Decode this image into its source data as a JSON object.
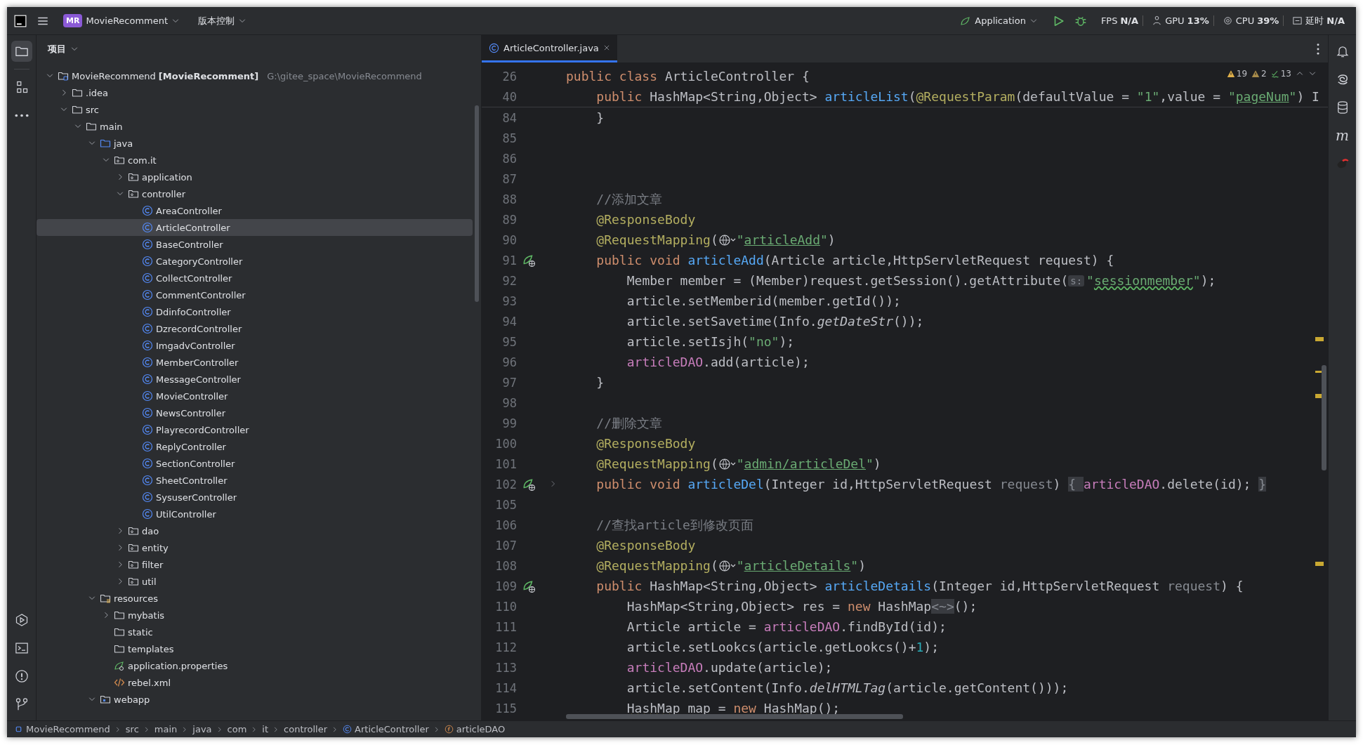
{
  "titlebar": {
    "project_badge": "MR",
    "project": "MovieRecomment",
    "vcs": "版本控制",
    "run_config": "Application",
    "monitors": [
      {
        "kind": "fps",
        "label": "FPS",
        "value": "N/A"
      },
      {
        "kind": "gpu",
        "label": "GPU",
        "value": "13%"
      },
      {
        "kind": "cpu",
        "label": "CPU",
        "value": "39%"
      },
      {
        "kind": "latency",
        "label": "延时",
        "value": "N/A"
      }
    ]
  },
  "left_toolbar": {
    "top": [
      {
        "kind": "project",
        "selected": true
      },
      {
        "kind": "structure",
        "selected": false
      },
      {
        "kind": "more",
        "selected": false
      }
    ],
    "bottom": [
      {
        "kind": "run",
        "selected": false
      },
      {
        "kind": "terminal",
        "selected": false
      },
      {
        "kind": "problems",
        "selected": false
      },
      {
        "kind": "git",
        "selected": false
      }
    ]
  },
  "right_toolbar": [
    {
      "kind": "notifications"
    },
    {
      "kind": "ai"
    },
    {
      "kind": "database"
    },
    {
      "kind": "letter",
      "label": "m"
    },
    {
      "kind": "plugin"
    }
  ],
  "project_panel": {
    "title": "项目",
    "tree": [
      {
        "label": "MovieRecommend",
        "module": "[MovieRecomment]",
        "path": "G:\\gitee_space\\MovieRecommend",
        "kind": "project",
        "expanded": true,
        "selected": false,
        "children": [
          {
            "label": ".idea",
            "kind": "folder",
            "expanded": false,
            "selected": false
          },
          {
            "label": "src",
            "kind": "folder",
            "expanded": true,
            "selected": false,
            "children": [
              {
                "label": "main",
                "kind": "folder",
                "expanded": true,
                "selected": false,
                "children": [
                  {
                    "label": "java",
                    "kind": "source",
                    "expanded": true,
                    "selected": false,
                    "children": [
                      {
                        "label": "com.it",
                        "kind": "package",
                        "expanded": true,
                        "selected": false,
                        "children": [
                          {
                            "label": "application",
                            "kind": "package",
                            "expanded": false,
                            "selected": false
                          },
                          {
                            "label": "controller",
                            "kind": "package",
                            "expanded": true,
                            "selected": false,
                            "children": [
                              {
                                "label": "AreaController",
                                "kind": "class",
                                "selected": false
                              },
                              {
                                "label": "ArticleController",
                                "kind": "class",
                                "selected": true
                              },
                              {
                                "label": "BaseController",
                                "kind": "class",
                                "selected": false
                              },
                              {
                                "label": "CategoryController",
                                "kind": "class",
                                "selected": false
                              },
                              {
                                "label": "CollectController",
                                "kind": "class",
                                "selected": false
                              },
                              {
                                "label": "CommentController",
                                "kind": "class",
                                "selected": false
                              },
                              {
                                "label": "DdinfoController",
                                "kind": "class",
                                "selected": false
                              },
                              {
                                "label": "DzrecordController",
                                "kind": "class",
                                "selected": false
                              },
                              {
                                "label": "ImgadvController",
                                "kind": "class",
                                "selected": false
                              },
                              {
                                "label": "MemberController",
                                "kind": "class",
                                "selected": false
                              },
                              {
                                "label": "MessageController",
                                "kind": "class",
                                "selected": false
                              },
                              {
                                "label": "MovieController",
                                "kind": "class",
                                "selected": false
                              },
                              {
                                "label": "NewsController",
                                "kind": "class",
                                "selected": false
                              },
                              {
                                "label": "PlayrecordController",
                                "kind": "class",
                                "selected": false
                              },
                              {
                                "label": "ReplyController",
                                "kind": "class",
                                "selected": false
                              },
                              {
                                "label": "SectionController",
                                "kind": "class",
                                "selected": false
                              },
                              {
                                "label": "SheetController",
                                "kind": "class",
                                "selected": false
                              },
                              {
                                "label": "SysuserController",
                                "kind": "class",
                                "selected": false
                              },
                              {
                                "label": "UtilController",
                                "kind": "class",
                                "selected": false
                              }
                            ]
                          },
                          {
                            "label": "dao",
                            "kind": "package",
                            "expanded": false,
                            "selected": false
                          },
                          {
                            "label": "entity",
                            "kind": "package",
                            "expanded": false,
                            "selected": false
                          },
                          {
                            "label": "filter",
                            "kind": "package",
                            "expanded": false,
                            "selected": false
                          },
                          {
                            "label": "util",
                            "kind": "package",
                            "expanded": false,
                            "selected": false
                          }
                        ]
                      }
                    ]
                  },
                  {
                    "label": "resources",
                    "kind": "resources",
                    "expanded": true,
                    "selected": false,
                    "children": [
                      {
                        "label": "mybatis",
                        "kind": "folder",
                        "expanded": false,
                        "selected": false
                      },
                      {
                        "label": "static",
                        "kind": "folder",
                        "selected": false
                      },
                      {
                        "label": "templates",
                        "kind": "folder",
                        "selected": false
                      },
                      {
                        "label": "application.properties",
                        "kind": "properties",
                        "selected": false
                      },
                      {
                        "label": "rebel.xml",
                        "kind": "xml",
                        "selected": false
                      }
                    ]
                  },
                  {
                    "label": "webapp",
                    "kind": "web",
                    "expanded": true,
                    "selected": false
                  }
                ]
              }
            ]
          }
        ]
      }
    ]
  },
  "editor": {
    "tabs": [
      {
        "label": "ArticleController.java",
        "selected": true
      }
    ],
    "inspections": {
      "warnings": "19",
      "weak_warnings": "2",
      "typos": "13"
    },
    "sticky_lines": [
      {
        "number": "26",
        "endpoint": false,
        "folded": false,
        "tokens": [
          {
            "kind": "kw",
            "text": "public class "
          },
          {
            "kind": "plain",
            "text": "ArticleController {"
          }
        ]
      },
      {
        "number": "40",
        "endpoint": false,
        "folded": false,
        "tokens": [
          {
            "kind": "kw",
            "text": "    public "
          },
          {
            "kind": "plain",
            "text": "HashMap<String,Object> "
          },
          {
            "kind": "fn",
            "text": "articleList"
          },
          {
            "kind": "plain",
            "text": "("
          },
          {
            "kind": "ann",
            "text": "@RequestParam"
          },
          {
            "kind": "plain",
            "text": "(defaultValue = "
          },
          {
            "kind": "str",
            "text": "\"1\""
          },
          {
            "kind": "plain",
            "text": ",value = "
          },
          {
            "kind": "str",
            "text": "\""
          },
          {
            "kind": "link",
            "text": "pageNum"
          },
          {
            "kind": "str",
            "text": "\""
          },
          {
            "kind": "plain",
            "text": ") I"
          }
        ]
      }
    ],
    "lines": [
      {
        "number": "84",
        "endpoint": false,
        "folded": false,
        "tokens": [
          {
            "kind": "plain",
            "text": "    }"
          }
        ]
      },
      {
        "number": "85",
        "endpoint": false,
        "folded": false
      },
      {
        "number": "86",
        "endpoint": false,
        "folded": false
      },
      {
        "number": "87",
        "endpoint": false,
        "folded": false
      },
      {
        "number": "88",
        "endpoint": false,
        "folded": false,
        "tokens": [
          {
            "kind": "comment",
            "text": "    //添加文章"
          }
        ]
      },
      {
        "number": "89",
        "endpoint": false,
        "folded": false,
        "tokens": [
          {
            "kind": "ann",
            "text": "    @ResponseBody"
          }
        ]
      },
      {
        "number": "90",
        "endpoint": false,
        "folded": false,
        "tokens": [
          {
            "kind": "ann",
            "text": "    @RequestMapping"
          },
          {
            "kind": "plain",
            "text": "("
          },
          {
            "kind": "globe"
          },
          {
            "kind": "str",
            "text": "\""
          },
          {
            "kind": "link",
            "text": "articleAdd"
          },
          {
            "kind": "str",
            "text": "\""
          },
          {
            "kind": "plain",
            "text": ")"
          }
        ]
      },
      {
        "number": "91",
        "endpoint": true,
        "folded": false,
        "tokens": [
          {
            "kind": "kw",
            "text": "    public void "
          },
          {
            "kind": "fn",
            "text": "articleAdd"
          },
          {
            "kind": "plain",
            "text": "(Article article,HttpServletRequest request) {"
          }
        ]
      },
      {
        "number": "92",
        "endpoint": false,
        "folded": false,
        "tokens": [
          {
            "kind": "plain",
            "text": "        Member member = (Member)request.getSession().getAttribute("
          },
          {
            "kind": "hint",
            "text": "s:"
          },
          {
            "kind": "str",
            "text": "\""
          },
          {
            "kind": "typo",
            "text": "sessionmember"
          },
          {
            "kind": "str",
            "text": "\""
          },
          {
            "kind": "plain",
            "text": ");"
          }
        ]
      },
      {
        "number": "93",
        "endpoint": false,
        "folded": false,
        "tokens": [
          {
            "kind": "plain",
            "text": "        article.setMemberid(member.getId());"
          }
        ]
      },
      {
        "number": "94",
        "endpoint": false,
        "folded": false,
        "tokens": [
          {
            "kind": "plain",
            "text": "        article.setSavetime(Info."
          },
          {
            "kind": "static",
            "text": "getDateStr"
          },
          {
            "kind": "plain",
            "text": "());"
          }
        ]
      },
      {
        "number": "95",
        "endpoint": false,
        "folded": false,
        "tokens": [
          {
            "kind": "plain",
            "text": "        article.setIsjh("
          },
          {
            "kind": "str",
            "text": "\"no\""
          },
          {
            "kind": "plain",
            "text": ");"
          }
        ]
      },
      {
        "number": "96",
        "endpoint": false,
        "folded": false,
        "tokens": [
          {
            "kind": "field",
            "text": "        articleDAO"
          },
          {
            "kind": "plain",
            "text": ".add(article);"
          }
        ]
      },
      {
        "number": "97",
        "endpoint": false,
        "folded": false,
        "tokens": [
          {
            "kind": "plain",
            "text": "    }"
          }
        ]
      },
      {
        "number": "98",
        "endpoint": false,
        "folded": false
      },
      {
        "number": "99",
        "endpoint": false,
        "folded": false,
        "tokens": [
          {
            "kind": "comment",
            "text": "    //删除文章"
          }
        ]
      },
      {
        "number": "100",
        "endpoint": false,
        "folded": false,
        "tokens": [
          {
            "kind": "ann",
            "text": "    @ResponseBody"
          }
        ]
      },
      {
        "number": "101",
        "endpoint": false,
        "folded": false,
        "tokens": [
          {
            "kind": "ann",
            "text": "    @RequestMapping"
          },
          {
            "kind": "plain",
            "text": "("
          },
          {
            "kind": "globe"
          },
          {
            "kind": "str",
            "text": "\""
          },
          {
            "kind": "link",
            "text": "admin/articleDel"
          },
          {
            "kind": "str",
            "text": "\""
          },
          {
            "kind": "plain",
            "text": ")"
          }
        ]
      },
      {
        "number": "102",
        "endpoint": true,
        "folded": true,
        "tokens": [
          {
            "kind": "kw",
            "text": "    public void "
          },
          {
            "kind": "fn",
            "text": "articleDel"
          },
          {
            "kind": "plain",
            "text": "(Integer id,HttpServletRequest "
          },
          {
            "kind": "unused",
            "text": "request"
          },
          {
            "kind": "plain",
            "text": ")"
          },
          {
            "kind": "fold",
            "text": " { "
          },
          {
            "kind": "field",
            "text": "articleDAO"
          },
          {
            "kind": "plain",
            "text": ".delete(id);"
          },
          {
            "kind": "fold",
            "text": " }"
          }
        ]
      },
      {
        "number": "105",
        "endpoint": false,
        "folded": false
      },
      {
        "number": "106",
        "endpoint": false,
        "folded": false,
        "tokens": [
          {
            "kind": "comment",
            "text": "    //查找article到修改页面"
          }
        ]
      },
      {
        "number": "107",
        "endpoint": false,
        "folded": false,
        "tokens": [
          {
            "kind": "ann",
            "text": "    @ResponseBody"
          }
        ]
      },
      {
        "number": "108",
        "endpoint": false,
        "folded": false,
        "tokens": [
          {
            "kind": "ann",
            "text": "    @RequestMapping"
          },
          {
            "kind": "plain",
            "text": "("
          },
          {
            "kind": "globe"
          },
          {
            "kind": "str",
            "text": "\""
          },
          {
            "kind": "link",
            "text": "articleDetails"
          },
          {
            "kind": "str",
            "text": "\""
          },
          {
            "kind": "plain",
            "text": ")"
          }
        ]
      },
      {
        "number": "109",
        "endpoint": true,
        "folded": false,
        "tokens": [
          {
            "kind": "kw",
            "text": "    public "
          },
          {
            "kind": "plain",
            "text": "HashMap<String,Object> "
          },
          {
            "kind": "fn",
            "text": "articleDetails"
          },
          {
            "kind": "plain",
            "text": "(Integer id,HttpServletRequest "
          },
          {
            "kind": "unused",
            "text": "request"
          },
          {
            "kind": "plain",
            "text": ") {"
          }
        ]
      },
      {
        "number": "110",
        "endpoint": false,
        "folded": false,
        "tokens": [
          {
            "kind": "plain",
            "text": "        HashMap<String,Object> res = "
          },
          {
            "kind": "kw",
            "text": "new "
          },
          {
            "kind": "plain",
            "text": "HashMap"
          },
          {
            "kind": "inlay",
            "text": "<~>"
          },
          {
            "kind": "plain",
            "text": "();"
          }
        ]
      },
      {
        "number": "111",
        "endpoint": false,
        "folded": false,
        "tokens": [
          {
            "kind": "plain",
            "text": "        Article article = "
          },
          {
            "kind": "field",
            "text": "articleDAO"
          },
          {
            "kind": "plain",
            "text": ".findById(id);"
          }
        ]
      },
      {
        "number": "112",
        "endpoint": false,
        "folded": false,
        "tokens": [
          {
            "kind": "plain",
            "text": "        article.setLookcs(article.getLookcs()+"
          },
          {
            "kind": "num",
            "text": "1"
          },
          {
            "kind": "plain",
            "text": ");"
          }
        ]
      },
      {
        "number": "113",
        "endpoint": false,
        "folded": false,
        "tokens": [
          {
            "kind": "field",
            "text": "        articleDAO"
          },
          {
            "kind": "plain",
            "text": ".update(article);"
          }
        ]
      },
      {
        "number": "114",
        "endpoint": false,
        "folded": false,
        "tokens": [
          {
            "kind": "plain",
            "text": "        article.setContent(Info."
          },
          {
            "kind": "static",
            "text": "delHTMLTag"
          },
          {
            "kind": "plain",
            "text": "(article.getContent()));"
          }
        ]
      },
      {
        "number": "115",
        "endpoint": false,
        "folded": false,
        "tokens": [
          {
            "kind": "warn",
            "text": "        HashMap"
          },
          {
            "kind": "plain",
            "text": " map = "
          },
          {
            "kind": "kw",
            "text": "new "
          },
          {
            "kind": "warn",
            "text": "HashMap"
          },
          {
            "kind": "plain",
            "text": "();"
          }
        ]
      }
    ]
  },
  "status_bar": {
    "breadcrumbs": [
      {
        "label": "MovieRecommend",
        "kind": "module"
      },
      {
        "label": "src",
        "kind": "plain"
      },
      {
        "label": "main",
        "kind": "plain"
      },
      {
        "label": "java",
        "kind": "plain"
      },
      {
        "label": "com",
        "kind": "plain"
      },
      {
        "label": "it",
        "kind": "plain"
      },
      {
        "label": "controller",
        "kind": "plain"
      },
      {
        "label": "ArticleController",
        "kind": "class"
      },
      {
        "label": "articleDAO",
        "kind": "field"
      }
    ]
  }
}
